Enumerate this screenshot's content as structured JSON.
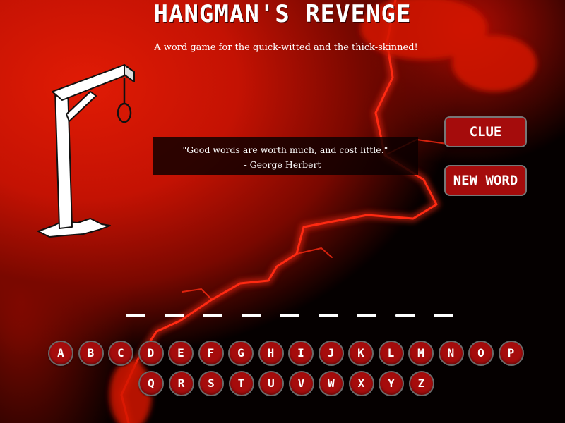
{
  "header": {
    "title": "HANGMAN'S REVENGE",
    "subtitle": "A word game for the quick-witted and the thick-skinned!"
  },
  "quote": {
    "text": "\"Good words are worth much, and cost little.\"",
    "author": "- George Herbert"
  },
  "buttons": {
    "clue": "CLUE",
    "new_word": "NEW WORD"
  },
  "word": {
    "letters_total": 9,
    "revealed": [
      "",
      "",
      "",
      "",
      "",
      "",
      "",
      "",
      ""
    ]
  },
  "alphabet": {
    "row1": [
      "A",
      "B",
      "C",
      "D",
      "E",
      "F",
      "G",
      "H",
      "I",
      "J",
      "K",
      "L",
      "M",
      "N",
      "O",
      "P"
    ],
    "row2": [
      "Q",
      "R",
      "S",
      "T",
      "U",
      "V",
      "W",
      "X",
      "Y",
      "Z"
    ]
  },
  "colors": {
    "accent": "#a50c0c",
    "background_red": "#e01b05",
    "background_dark": "#050000",
    "text": "#ffffff"
  }
}
